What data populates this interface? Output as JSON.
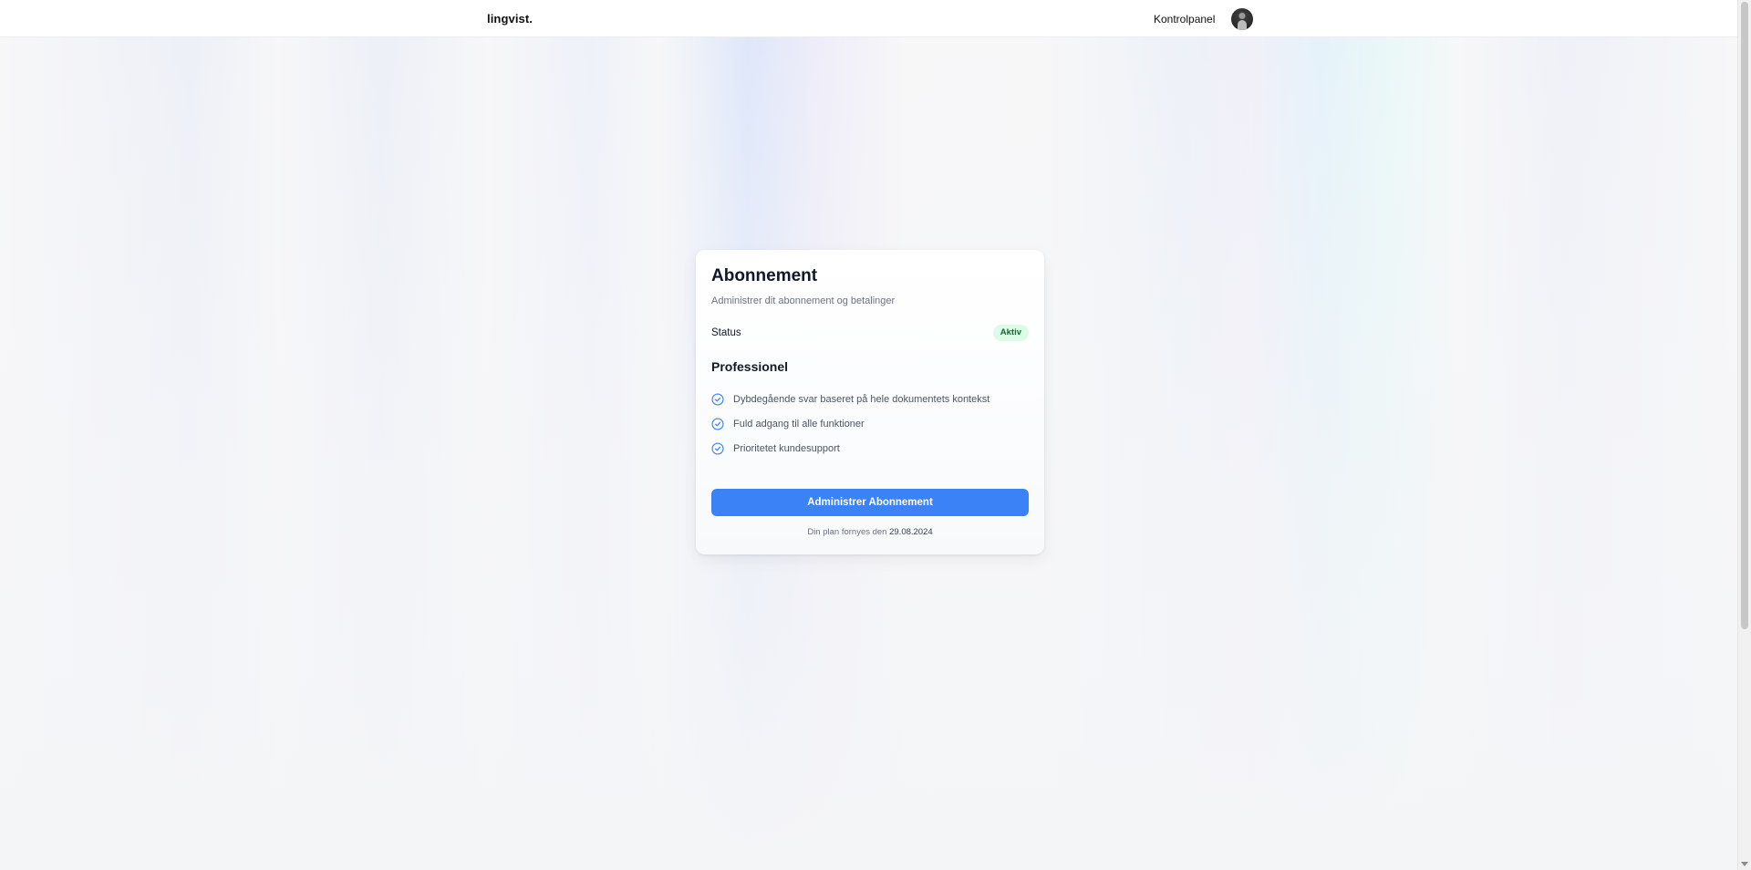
{
  "header": {
    "logo": "lingvist.",
    "nav_link": "Kontrolpanel"
  },
  "card": {
    "title": "Abonnement",
    "subtitle": "Administrer dit abonnement og betalinger",
    "status_label": "Status",
    "status_badge": "Aktiv",
    "plan_name": "Professionel",
    "features": [
      "Dybdegående svar baseret på hele dokumentets kontekst",
      "Fuld adgang til alle funktioner",
      "Prioritetet kundesupport"
    ],
    "button_label": "Administrer Abonnement",
    "renewal_text": "Din plan fornyes den",
    "renewal_date": "29.08.2024"
  },
  "icons": {
    "feature": "check-circle-icon",
    "avatar": "user-avatar"
  },
  "colors": {
    "accent": "#3b82f6",
    "badge_bg": "#dcfce7",
    "badge_text": "#166534"
  }
}
